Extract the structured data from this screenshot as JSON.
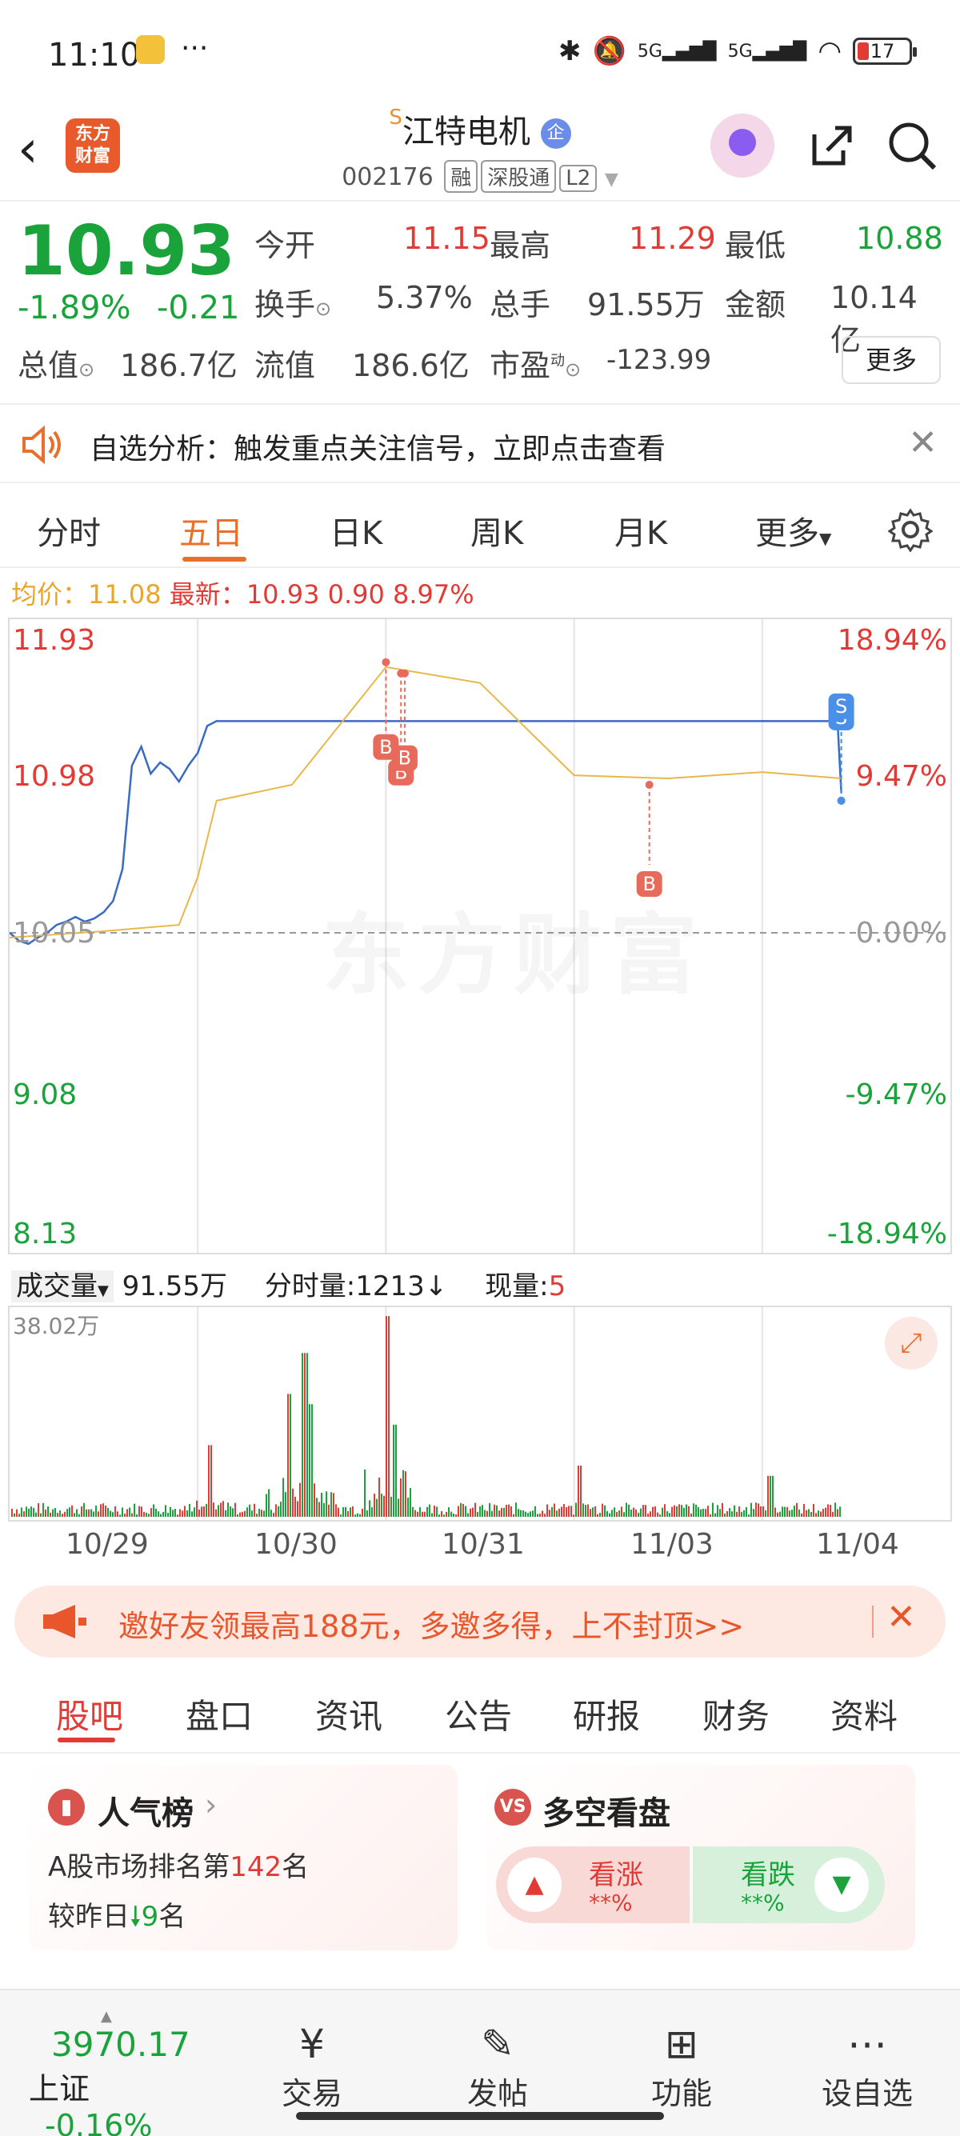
{
  "status_bar": {
    "time": "11:10",
    "dots": "···",
    "battery": "17",
    "net1": "5G",
    "net2": "5G"
  },
  "header": {
    "logo_text": "东方\n财富",
    "stock_name": "江特电机",
    "special_mark": "S",
    "qi_badge": "企",
    "code": "002176",
    "tags": [
      "融",
      "深股通",
      "L2"
    ]
  },
  "quote": {
    "price": "10.93",
    "change_pct": "-1.89%",
    "change_amt": "-0.21",
    "rows": [
      [
        {
          "k": "今开",
          "v": "11.15"
        },
        {
          "k": "最高",
          "v": "11.29"
        },
        {
          "k": "最低",
          "v": "10.88"
        }
      ],
      [
        {
          "k": "换手",
          "v": "5.37%"
        },
        {
          "k": "总手",
          "v": "91.55万"
        },
        {
          "k": "金额",
          "v": "10.14亿"
        }
      ],
      [
        {
          "k": "总值",
          "v": "186.7亿"
        },
        {
          "k": "流值",
          "v": "186.6亿"
        },
        {
          "k": "市盈",
          "v": "-123.99",
          "sup": "动"
        }
      ]
    ],
    "more": "更多"
  },
  "notice": {
    "text": "自选分析：触发重点关注信号，立即点击查看"
  },
  "chart_tabs": [
    "分时",
    "五日",
    "日K",
    "周K",
    "月K",
    "更多"
  ],
  "active_chart_tab": "五日",
  "avg_line": {
    "avg_label": "均价：",
    "avg": "11.08",
    "latest_label": "最新：",
    "latest": "10.93",
    "chg": "0.90",
    "pct": "8.97%"
  },
  "watermark": "东方财富",
  "chart_data": {
    "type": "line",
    "title": "",
    "y_left_ticks": [
      "11.93",
      "10.98",
      "10.05",
      "9.08",
      "8.13"
    ],
    "y_right_ticks": [
      "18.94%",
      "9.47%",
      "0.00%",
      "-9.47%",
      "-18.94%"
    ],
    "ylim": [
      8.13,
      11.93
    ],
    "x_days": [
      "10/29",
      "10/30",
      "10/31",
      "11/03",
      "11/04"
    ],
    "series": [
      {
        "name": "价格",
        "color": "#3a6bc4",
        "x": [
          0,
          0.05,
          0.1,
          0.15,
          0.2,
          0.25,
          0.3,
          0.35,
          0.4,
          0.45,
          0.5,
          0.55,
          0.6,
          0.65,
          0.7,
          0.75,
          0.8,
          0.85,
          0.9,
          0.95,
          1.0,
          1.05,
          1.1,
          1.15,
          1.2,
          1.25,
          1.3,
          1.35,
          1.4,
          1.45,
          1.5,
          1.55,
          1.6,
          1.65,
          1.7,
          1.75,
          1.8,
          1.85,
          1.9,
          1.95,
          2.0,
          2.05,
          2.1,
          2.15,
          2.2,
          2.3,
          2.4,
          2.5,
          2.6,
          2.7,
          2.8,
          2.9,
          3.0,
          3.05,
          3.1,
          3.2,
          3.3,
          3.4,
          3.5,
          3.6,
          3.7,
          3.8,
          3.9,
          4.0,
          4.05,
          4.1,
          4.2,
          4.3,
          4.4,
          4.42
        ],
        "values": [
          10.05,
          10.0,
          9.98,
          10.02,
          10.05,
          10.1,
          10.12,
          10.15,
          10.12,
          10.14,
          10.18,
          10.25,
          10.45,
          11.1,
          11.22,
          11.05,
          11.12,
          11.08,
          11.0,
          11.1,
          11.18,
          11.35,
          11.38,
          11.38,
          11.38,
          11.38,
          11.38,
          11.38,
          11.38,
          11.38,
          11.38,
          11.38,
          11.38,
          11.38,
          11.38,
          11.38,
          11.38,
          11.38,
          11.38,
          11.38,
          11.38,
          11.38,
          11.38,
          11.38,
          11.38,
          11.38,
          11.38,
          11.38,
          11.38,
          11.38,
          11.38,
          11.38,
          11.38,
          11.38,
          11.38,
          11.38,
          11.38,
          11.38,
          11.38,
          11.38,
          11.38,
          11.38,
          11.38,
          11.38,
          11.38,
          11.38,
          11.38,
          11.38,
          11.38,
          10.93
        ]
      },
      {
        "name": "均价",
        "color": "#e8b84a",
        "x": [
          0,
          0.5,
          0.9,
          1.0,
          1.1,
          1.5,
          2.0,
          2.5,
          3.0,
          3.5,
          4.0,
          4.42
        ],
        "values": [
          10.02,
          10.06,
          10.1,
          10.4,
          10.88,
          10.98,
          11.72,
          11.62,
          11.04,
          11.02,
          11.06,
          11.02
        ]
      }
    ],
    "markers": [
      {
        "label": "B",
        "x": 2.0,
        "y": 11.75
      },
      {
        "label": "B",
        "x": 2.08,
        "y": 11.68
      },
      {
        "label": "B",
        "x": 2.1,
        "y": 11.68
      },
      {
        "label": "B",
        "x": 3.4,
        "y": 10.98
      },
      {
        "label": "S",
        "x": 4.42,
        "y": 10.88
      },
      {
        "label": "S",
        "x": 4.42,
        "y": 10.88
      }
    ]
  },
  "volume": {
    "label": "成交量",
    "total": "91.55万",
    "tick_label": "分时量:",
    "tick": "1213",
    "now_label": "现量:",
    "now": "5",
    "max": "38.02万"
  },
  "banner": {
    "text": "邀好友领最高188元，多邀多得，上不封顶>>"
  },
  "bottom_tabs": [
    "股吧",
    "盘口",
    "资讯",
    "公告",
    "研报",
    "财务",
    "资料"
  ],
  "cards": {
    "popularity": {
      "title": "人气榜",
      "line1_pre": "A股市场排名第",
      "rank": "142",
      "line1_post": "名",
      "line2_pre": "较昨日",
      "delta": "9",
      "line2_post": "名"
    },
    "bullbear": {
      "title": "多空看盘",
      "bull": "看涨",
      "bull_pct": "**%",
      "bear": "看跌",
      "bear_pct": "**%"
    }
  },
  "footer": {
    "index_value": "3970.17",
    "index_name": "上证",
    "index_chg": "-0.16%",
    "items": [
      "交易",
      "发帖",
      "功能",
      "设自选"
    ]
  }
}
